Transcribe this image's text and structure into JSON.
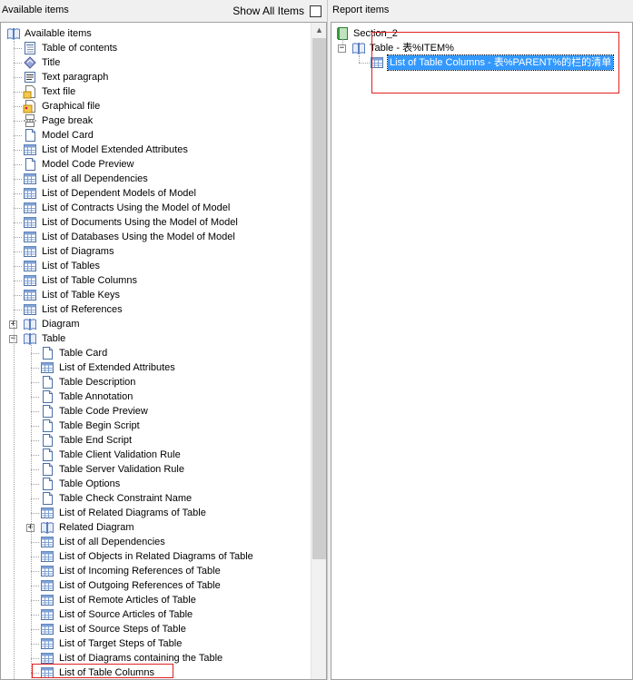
{
  "left_pane": {
    "title": "Available items",
    "show_all_label": "Show All Items",
    "show_all_checked": false,
    "tree": {
      "root": "Available items",
      "items": [
        {
          "label": "Table of contents",
          "icon": "toc-icon"
        },
        {
          "label": "Title",
          "icon": "title-icon"
        },
        {
          "label": "Text paragraph",
          "icon": "text-paragraph-icon"
        },
        {
          "label": "Text file",
          "icon": "text-file-icon"
        },
        {
          "label": "Graphical file",
          "icon": "graphical-file-icon"
        },
        {
          "label": "Page break",
          "icon": "page-break-icon"
        },
        {
          "label": "Model Card",
          "icon": "document-icon"
        },
        {
          "label": "List of Model Extended Attributes",
          "icon": "list-icon"
        },
        {
          "label": "Model Code Preview",
          "icon": "document-icon"
        },
        {
          "label": "List of all Dependencies",
          "icon": "list-icon"
        },
        {
          "label": "List of Dependent Models of Model",
          "icon": "list-icon"
        },
        {
          "label": "List of Contracts Using the Model of Model",
          "icon": "list-icon"
        },
        {
          "label": "List of Documents Using the Model of Model",
          "icon": "list-icon"
        },
        {
          "label": "List of Databases Using the Model of Model",
          "icon": "list-icon"
        },
        {
          "label": "List of Diagrams",
          "icon": "list-icon"
        },
        {
          "label": "List of Tables",
          "icon": "list-icon"
        },
        {
          "label": "List of Table Columns",
          "icon": "list-icon"
        },
        {
          "label": "List of Table Keys",
          "icon": "list-icon"
        },
        {
          "label": "List of References",
          "icon": "list-icon"
        },
        {
          "label": "Diagram",
          "icon": "book-icon",
          "expander": "+"
        },
        {
          "label": "Table",
          "icon": "book-icon",
          "expander": "-"
        }
      ],
      "table_children": [
        {
          "label": "Table Card",
          "icon": "document-icon"
        },
        {
          "label": "List of Extended Attributes",
          "icon": "list-icon"
        },
        {
          "label": "Table Description",
          "icon": "document-icon"
        },
        {
          "label": "Table Annotation",
          "icon": "document-icon"
        },
        {
          "label": "Table Code Preview",
          "icon": "document-icon"
        },
        {
          "label": "Table Begin Script",
          "icon": "document-icon"
        },
        {
          "label": "Table End Script",
          "icon": "document-icon"
        },
        {
          "label": "Table Client Validation Rule",
          "icon": "document-icon"
        },
        {
          "label": "Table Server Validation Rule",
          "icon": "document-icon"
        },
        {
          "label": "Table Options",
          "icon": "document-icon"
        },
        {
          "label": "Table Check Constraint Name",
          "icon": "document-icon"
        },
        {
          "label": "List of Related Diagrams of Table",
          "icon": "list-icon"
        },
        {
          "label": "Related Diagram",
          "icon": "book-icon",
          "expander": "+"
        },
        {
          "label": "List of all Dependencies",
          "icon": "list-icon"
        },
        {
          "label": "List of Objects in Related Diagrams of Table",
          "icon": "list-icon"
        },
        {
          "label": "List of Incoming References of Table",
          "icon": "list-icon"
        },
        {
          "label": "List of Outgoing References of Table",
          "icon": "list-icon"
        },
        {
          "label": "List of Remote Articles of Table",
          "icon": "list-icon"
        },
        {
          "label": "List of Source Articles of Table",
          "icon": "list-icon"
        },
        {
          "label": "List of Source Steps of Table",
          "icon": "list-icon"
        },
        {
          "label": "List of Target Steps of Table",
          "icon": "list-icon"
        },
        {
          "label": "List of Diagrams containing the Table",
          "icon": "list-icon"
        },
        {
          "label": "List of Table Columns",
          "icon": "list-icon",
          "highlighted": true
        }
      ]
    }
  },
  "right_pane": {
    "title": "Report items",
    "tree": {
      "section": "Section_2",
      "table_node": "Table - 表%ITEM%",
      "selected_item": "List of Table Columns - 表%PARENT%的栏的清单"
    }
  },
  "colors": {
    "selection": "#3399ff",
    "highlight_box": "#e02020",
    "book_icon": "#5a7fc0",
    "section_icon": "#3a9a3a"
  }
}
